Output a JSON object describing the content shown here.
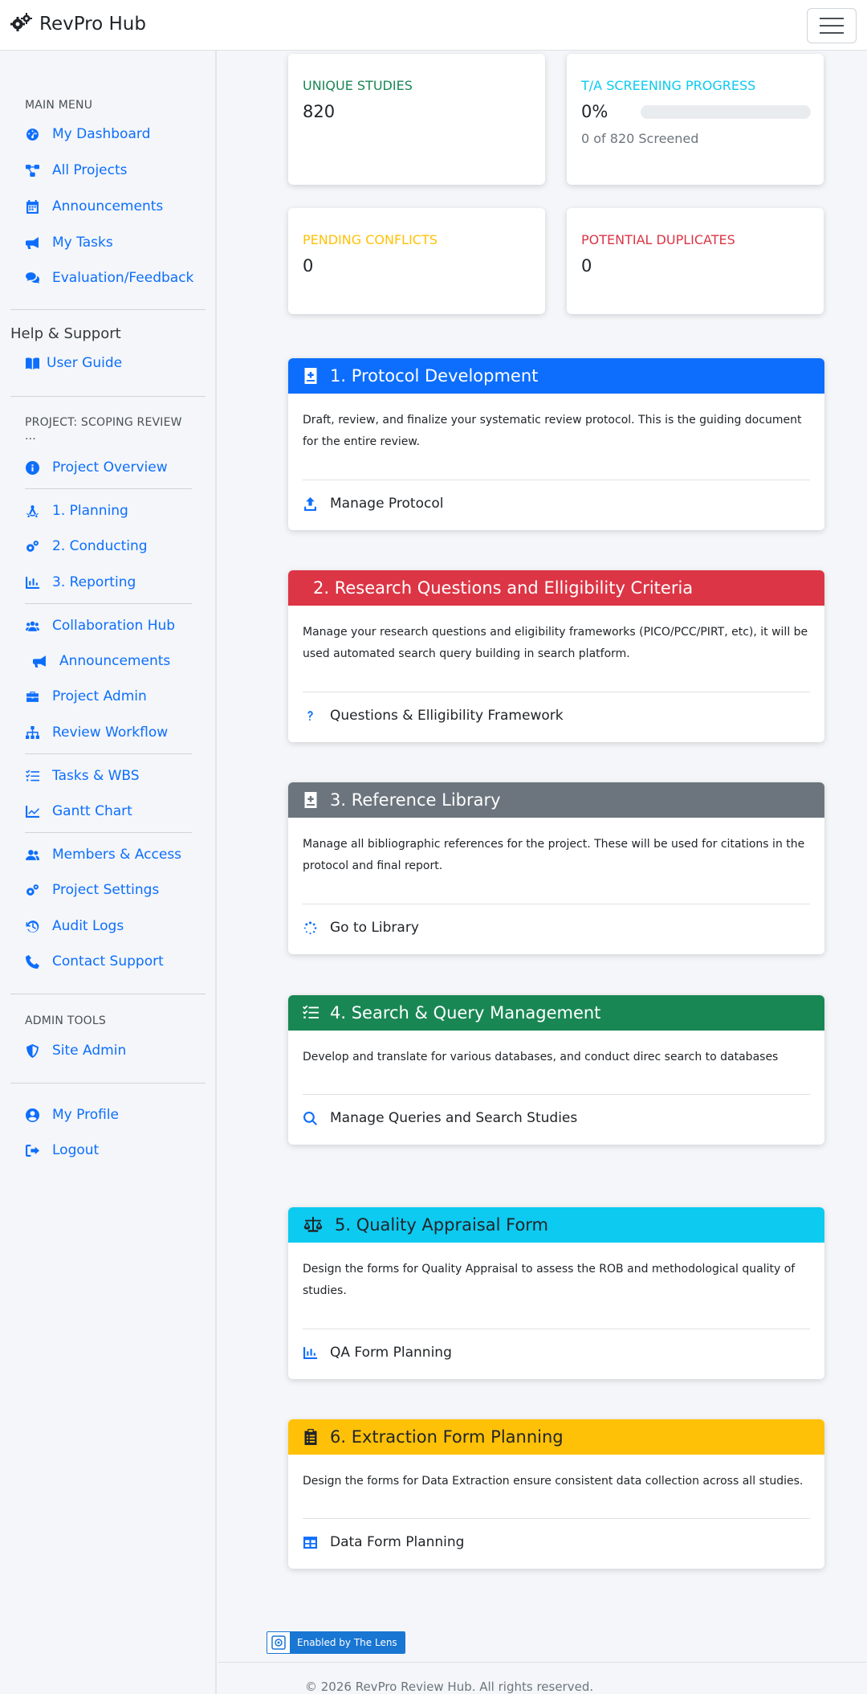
{
  "app": {
    "brand": "RevPro Hub",
    "menu_toggle": "menu-toggle"
  },
  "colors": {
    "primary": "#0d6efd",
    "danger": "#dc3545",
    "secondary": "#6c757d",
    "success": "#198754",
    "info": "#0dcaf0",
    "warning": "#ffc107",
    "teal_text": "#198754"
  },
  "sidebar": {
    "main_menu_heading": "MAIN MENU",
    "main_items": [
      {
        "label": "My Dashboard",
        "icon": "dashboard-icon"
      },
      {
        "label": "All Projects",
        "icon": "project-diagram-icon"
      },
      {
        "label": "Announcements",
        "icon": "calendar-icon"
      },
      {
        "label": "My Tasks",
        "icon": "megaphone-icon"
      },
      {
        "label": "Evaluation/Feedback",
        "icon": "comments-icon"
      }
    ],
    "help_heading": "Help & Support",
    "help_items": [
      {
        "label": "User Guide",
        "icon": "book-icon"
      }
    ],
    "project_heading": "PROJECT: SCOPING REVIEW",
    "project_heading_more": "...",
    "project_items": [
      {
        "label": "Project Overview",
        "icon": "info-circle-icon"
      },
      {
        "label": "1. Planning",
        "icon": "compass-drafting-icon"
      },
      {
        "label": "2. Conducting",
        "icon": "cogs-icon"
      },
      {
        "label": "3. Reporting",
        "icon": "chart-bar-icon"
      },
      {
        "label": "Collaboration Hub",
        "icon": "users-icon"
      },
      {
        "label": "Announcements",
        "icon": "megaphone-icon"
      },
      {
        "label": "Project Admin",
        "icon": "toolbox-icon"
      },
      {
        "label": "Review Workflow",
        "icon": "sitemap-icon"
      },
      {
        "label": "Tasks & WBS",
        "icon": "list-check-icon"
      },
      {
        "label": "Gantt Chart",
        "icon": "chart-line-icon"
      },
      {
        "label": "Members & Access",
        "icon": "user-group-icon"
      },
      {
        "label": "Project Settings",
        "icon": "cogs-icon"
      },
      {
        "label": "Audit Logs",
        "icon": "history-icon"
      },
      {
        "label": "Contact Support",
        "icon": "phone-icon"
      }
    ],
    "admin_heading": "ADMIN TOOLS",
    "admin_items": [
      {
        "label": "Site Admin",
        "icon": "shield-icon"
      }
    ],
    "account_items": [
      {
        "label": "My Profile",
        "icon": "user-circle-icon"
      },
      {
        "label": "Logout",
        "icon": "sign-out-icon"
      }
    ]
  },
  "stats": {
    "unique_studies": {
      "label": "UNIQUE STUDIES",
      "value": "820"
    },
    "screening": {
      "label": "T/A SCREENING PROGRESS",
      "value": "0%",
      "progress": 0,
      "sub": "0 of 820 Screened"
    },
    "conflicts": {
      "label": "PENDING CONFLICTS",
      "value": "0"
    },
    "duplicates": {
      "label": "POTENTIAL DUPLICATES",
      "value": "0"
    }
  },
  "sections": [
    {
      "title": "1. Protocol Development",
      "icon": "file-medical-icon",
      "desc": "Draft, review, and finalize your systematic review protocol. This is the guiding document for the entire review.",
      "link": "Manage Protocol",
      "link_icon": "upload-icon"
    },
    {
      "title": "2. Research Questions and Elligibility Criteria",
      "icon": "",
      "desc": "Manage your research questions and eligibility frameworks (PICO/PCC/PIRT, etc), it will be used automated search query building in search platform.",
      "link": "Questions & Elligibility Framework",
      "link_icon": "question-icon"
    },
    {
      "title": "3. Reference Library",
      "icon": "file-medical-icon",
      "desc": "Manage all bibliographic references for the project. These will be used for citations in the protocol and final report.",
      "link": "Go to Library",
      "link_icon": "spinner-icon"
    },
    {
      "title": "4. Search & Query Management",
      "icon": "list-check-icon",
      "desc": "Develop and translate for various databases, and conduct direc search to databases",
      "link": "Manage Queries and Search Studies",
      "link_icon": "search-icon"
    },
    {
      "title": "5. Quality Appraisal Form",
      "icon": "scale-balanced-icon",
      "desc": "Design the forms for Quality Appraisal to assess the ROB and methodological quality of studies.",
      "link": "QA Form Planning",
      "link_icon": "chart-bar-icon"
    },
    {
      "title": "6. Extraction Form Planning",
      "icon": "clipboard-icon",
      "desc": "Design the forms for Data Extraction ensure consistent data collection across all studies.",
      "link": "Data Form Planning",
      "link_icon": "table-icon"
    }
  ],
  "lens_badge": "Enabled by The Lens",
  "footer": "© 2026 RevPro Review Hub. All rights reserved."
}
